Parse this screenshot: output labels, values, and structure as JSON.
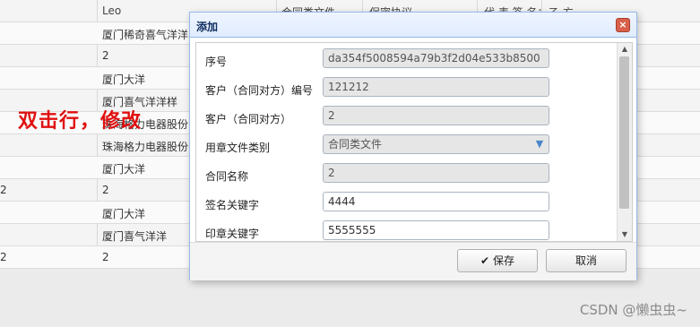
{
  "grid": {
    "header": [
      "Leo",
      "合同类文件",
      "保密协议",
      "代 表 签 名：",
      "乙 方"
    ],
    "rows": [
      {
        "c0": "",
        "c1": "厦门稀奇喜气洋洋"
      },
      {
        "c0": "",
        "c1": "2"
      },
      {
        "c0": "",
        "c1": "厦门大洋"
      },
      {
        "c0": "",
        "c1": "厦门喜气洋洋样"
      },
      {
        "c0": "",
        "c1": "珠海格力电器股份"
      },
      {
        "c0": "",
        "c1": "珠海格力电器股份有"
      },
      {
        "c0": "",
        "c1": "厦门大洋"
      },
      {
        "c0": "2",
        "c1": "2"
      },
      {
        "c0": "",
        "c1": "厦门大洋"
      },
      {
        "c0": "",
        "c1": "厦门喜气洋洋"
      },
      {
        "c0": "2",
        "c1": "2"
      }
    ]
  },
  "overlay": {
    "text": "双击行，修改"
  },
  "dialog": {
    "title": "添加",
    "close": "×",
    "fields": {
      "seq": {
        "label": "序号",
        "value": "da354f5008594a79b3f2d04e533b8500"
      },
      "customer_no": {
        "label": "客户（合同对方）编号",
        "value": "121212"
      },
      "customer": {
        "label": "客户（合同对方）",
        "value": "2"
      },
      "seal_type": {
        "label": "用章文件类别",
        "value": "合同类文件"
      },
      "contract_name": {
        "label": "合同名称",
        "value": "2"
      },
      "sign_keyword": {
        "label": "签名关键字",
        "value": "4444"
      },
      "seal_keyword": {
        "label": "印章关键字",
        "value": "5555555"
      }
    },
    "buttons": {
      "save": "保存",
      "cancel": "取消",
      "save_icon": "✔"
    }
  },
  "watermark": "CSDN @懒虫虫~"
}
